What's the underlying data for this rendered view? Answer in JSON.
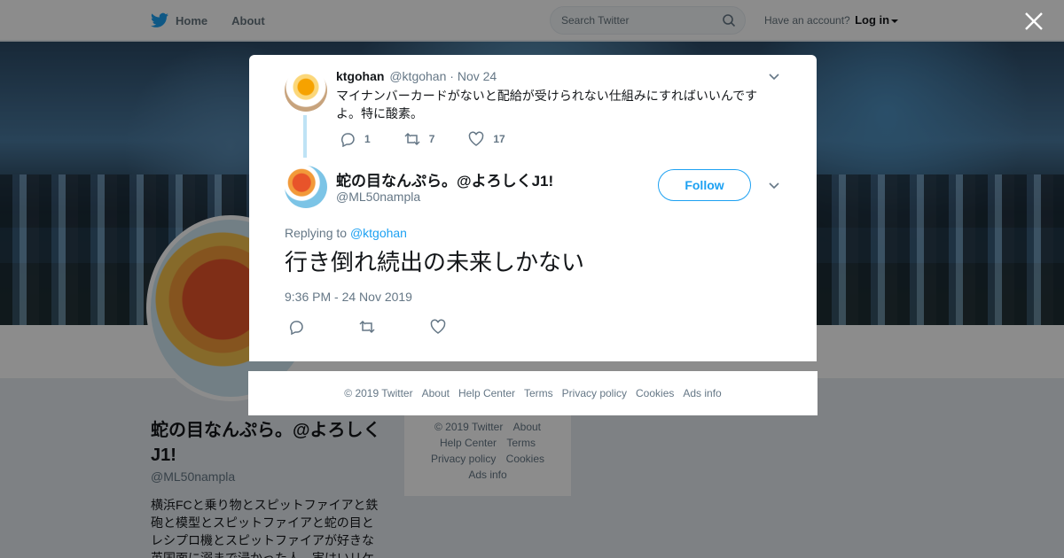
{
  "nav": {
    "home_label": "Home",
    "about_label": "About",
    "search_placeholder": "Search Twitter",
    "account_prompt": "Have an account?",
    "login_label": "Log in"
  },
  "profile": {
    "name": "蛇の目なんぷら。@よろしくJ1!",
    "handle": "@ML50nampla",
    "bio": "横浜FCと乗り物とスピットファイアと鉄砲と模型とスピットファイアと蛇の目とレシプロ機とスピットファイアが好きな英国面に溺まで浸かった人。実はいリケ"
  },
  "side_footer": {
    "items": [
      "© 2019 Twitter",
      "About",
      "Help Center",
      "Terms",
      "Privacy policy",
      "Cookies",
      "Ads info"
    ]
  },
  "parent_tweet": {
    "name": "ktgohan",
    "handle": "@ktgohan",
    "separator": "·",
    "date": "Nov 24",
    "text": "マイナンバーカードがないと配給が受けられない仕組みにすればいいんですよ。特に酸素。",
    "replies": "1",
    "retweets": "7",
    "likes": "17"
  },
  "main_tweet": {
    "name": "蛇の目なんぷら。@よろしくJ1!",
    "handle": "@ML50nampla",
    "follow_label": "Follow",
    "replying_prefix": "Replying to",
    "replying_to": "@ktgohan",
    "text": "行き倒れ続出の未来しかない",
    "timestamp": "9:36 PM - 24 Nov 2019"
  },
  "modal_footer": {
    "items": [
      "© 2019 Twitter",
      "About",
      "Help Center",
      "Terms",
      "Privacy policy",
      "Cookies",
      "Ads info"
    ]
  },
  "colors": {
    "brand": "#1da1f2",
    "text": "#14171a",
    "muted": "#657786"
  }
}
